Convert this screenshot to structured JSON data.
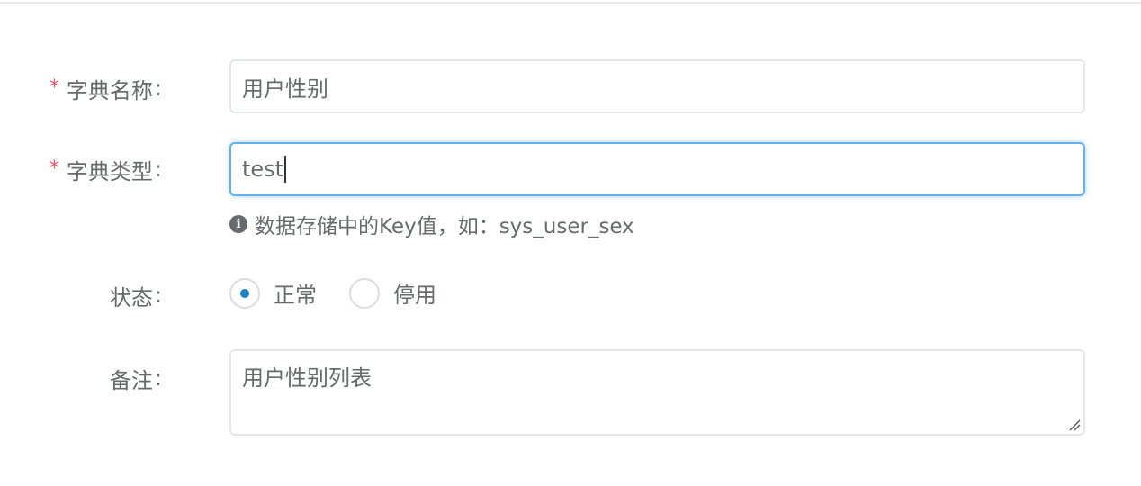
{
  "form": {
    "dict_name": {
      "label": "字典名称",
      "required_mark": "*",
      "colon": ":",
      "value": "用户性别"
    },
    "dict_type": {
      "label": "字典类型",
      "required_mark": "*",
      "colon": ":",
      "value": "test",
      "help_text": "数据存储中的Key值，如：sys_user_sex"
    },
    "status": {
      "label": "状态",
      "colon": ":",
      "options": [
        {
          "label": "正常",
          "checked": true
        },
        {
          "label": "停用",
          "checked": false
        }
      ]
    },
    "remark": {
      "label": "备注",
      "colon": ":",
      "value": "用户性别列表"
    }
  },
  "icons": {
    "help": "info-circle-icon",
    "resize": "resize-handle-icon"
  },
  "colors": {
    "required": "#ed5565",
    "focus_border": "#66afe9",
    "radio_selected": "#1c84c6",
    "text": "#676a6c"
  }
}
